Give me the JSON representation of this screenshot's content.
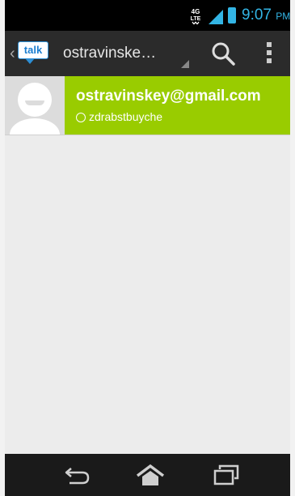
{
  "status_bar": {
    "network": "4G LTE",
    "time": "9:07",
    "ampm": "PM",
    "accent": "#33b5e5"
  },
  "action_bar": {
    "app_icon_text": "talk",
    "account": "ostravinske…"
  },
  "conversation": {
    "email": "ostravinskey@gmail.com",
    "status": "zdrabstbuyche",
    "highlight_color": "#99cc00"
  },
  "icons": {
    "search": "search-icon",
    "overflow": "overflow-menu-icon",
    "back": "back-icon",
    "home": "home-icon",
    "recents": "recent-apps-icon"
  }
}
